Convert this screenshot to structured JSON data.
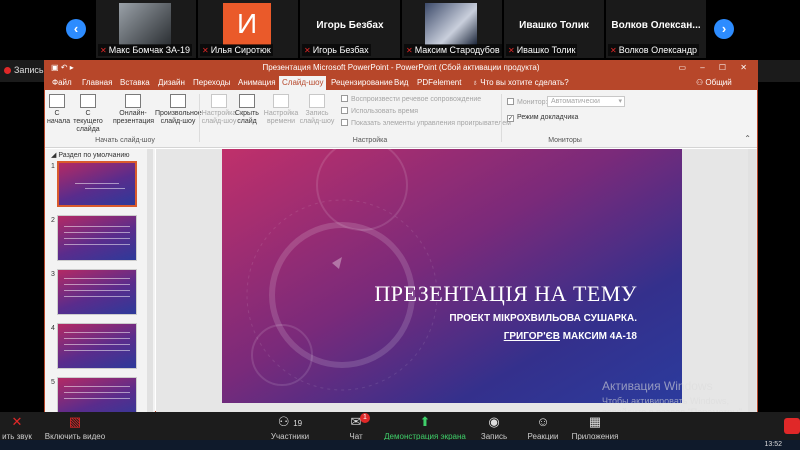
{
  "gallery": {
    "participants": [
      {
        "name": "Макс Бомчак ЗА-19",
        "type": "photo"
      },
      {
        "name": "Илья Сиротюк",
        "type": "letter",
        "letter": "И"
      },
      {
        "name": "Игорь Безбах",
        "type": "text",
        "label": "Игорь Безбах"
      },
      {
        "name": "Максим Стародубов",
        "type": "photo"
      },
      {
        "name": "Ивашко Толик",
        "type": "text",
        "label": "Ивашко Толик"
      },
      {
        "name": "Волков Олександр",
        "type": "text",
        "label": "Волков  Олексан..."
      }
    ],
    "prev_icon": "chevron-left-icon",
    "next_icon": "chevron-right-icon"
  },
  "recording": {
    "label": "Запись"
  },
  "ppt": {
    "window_title": "Презентация Microsoft PowerPoint - PowerPoint (Сбой активации продукта)",
    "tabs": [
      "Файл",
      "Главная",
      "Вставка",
      "Дизайн",
      "Переходы",
      "Анимация",
      "Слайд-шоу",
      "Рецензирование",
      "Вид",
      "PDFelement"
    ],
    "active_tab": "Слайд-шоу",
    "tell_me": "Что вы хотите сделать?",
    "share": "Общий доступ",
    "ribbon": {
      "from_start": "С начала",
      "from_current": "С текущего слайда",
      "online": "Онлайн-презентация",
      "custom": "Произвольное слайд-шоу",
      "group_start": "Начать слайд-шоу",
      "setup": "Настройка слайд-шоу",
      "hide": "Скрыть слайд",
      "rehearse": "Настройка времени",
      "record": "Запись слайд-шоу",
      "chk_narration": "Воспроизвести речевое сопровождение",
      "chk_timings": "Использовать время",
      "chk_media": "Показать элементы управления проигрывателем",
      "group_setup": "Настройка",
      "monitor_label": "Монитор:",
      "monitor_value": "Автоматически",
      "presenter_view": "Режим докладчика",
      "group_monitors": "Мониторы"
    },
    "section": "Раздел по умолчанию",
    "slide_numbers": [
      "1",
      "2",
      "3",
      "4",
      "5"
    ]
  },
  "slide": {
    "title": "ПРЕЗЕНТАЦІЯ НА ТЕМУ",
    "line1": "ПРОЕКТ МІКРОХВИЛЬОВА СУШАРКА.",
    "line2_name": "ГРИГОР'ЄВ",
    "line2_rest": " МАКСИМ 4А-18"
  },
  "watermark": {
    "title": "Активация Windows",
    "text": "Чтобы активировать Windows, перейдите в раздел \"Параметры\"."
  },
  "toolbar": {
    "mute": "ить звук",
    "video": "Включить видео",
    "participants": "Участники",
    "participants_count": "19",
    "chat": "Чат",
    "chat_badge": "1",
    "share": "Демонстрация экрана",
    "record": "Запись",
    "reactions": "Реакции",
    "apps": "Приложения"
  },
  "clock": "13:52"
}
